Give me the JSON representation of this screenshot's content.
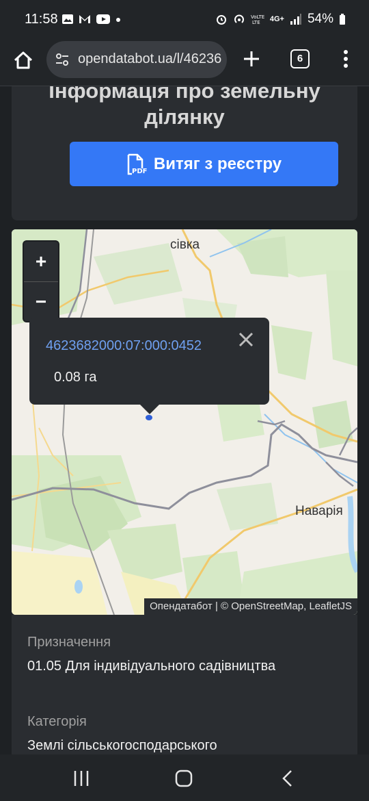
{
  "status": {
    "time": "11:58",
    "battery": "54%",
    "network_label": "4G+"
  },
  "browser": {
    "url": "opendatabot.ua/l/46236",
    "tab_count": "6"
  },
  "card": {
    "title_line1": "Інформація про земельну",
    "title_line2": "ділянку",
    "pdf_label": "Витяг з реєстру",
    "pdf_badge": "PDF"
  },
  "map": {
    "zoom_in": "+",
    "zoom_out": "−",
    "places": [
      "сівка",
      "Наварія"
    ],
    "attribution": "Опендатабот | © OpenStreetMap, LeafletJS",
    "popup": {
      "parcel_id": "4623682000:07:000:0452",
      "area": "0.08 га"
    }
  },
  "details": [
    {
      "label": "Призначення",
      "value": "01.05 Для індивідуального садівництва"
    },
    {
      "label": "Категорія",
      "value": "Землі сільськогосподарського"
    }
  ],
  "colors": {
    "accent": "#3478f6",
    "link": "#6fa0f0",
    "card_bg": "#2a2d31",
    "page_bg": "#1e2124"
  }
}
